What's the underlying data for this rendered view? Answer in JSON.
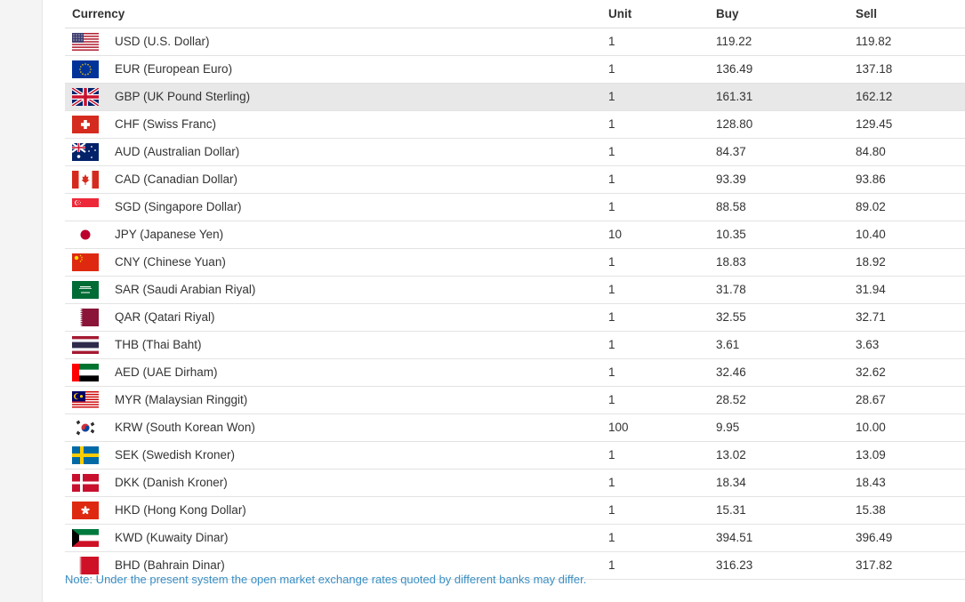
{
  "table": {
    "headers": {
      "currency": "Currency",
      "unit": "Unit",
      "buy": "Buy",
      "sell": "Sell"
    },
    "rows": [
      {
        "flag": "us-flag-icon",
        "currency": "USD (U.S. Dollar)",
        "unit": "1",
        "buy": "119.22",
        "sell": "119.82"
      },
      {
        "flag": "eu-flag-icon",
        "currency": "EUR (European Euro)",
        "unit": "1",
        "buy": "136.49",
        "sell": "137.18"
      },
      {
        "flag": "uk-flag-icon",
        "currency": "GBP (UK Pound Sterling)",
        "unit": "1",
        "buy": "161.31",
        "sell": "162.12"
      },
      {
        "flag": "ch-flag-icon",
        "currency": "CHF (Swiss Franc)",
        "unit": "1",
        "buy": "128.80",
        "sell": "129.45"
      },
      {
        "flag": "au-flag-icon",
        "currency": "AUD (Australian Dollar)",
        "unit": "1",
        "buy": "84.37",
        "sell": "84.80"
      },
      {
        "flag": "ca-flag-icon",
        "currency": "CAD (Canadian Dollar)",
        "unit": "1",
        "buy": "93.39",
        "sell": "93.86"
      },
      {
        "flag": "sg-flag-icon",
        "currency": "SGD (Singapore Dollar)",
        "unit": "1",
        "buy": "88.58",
        "sell": "89.02"
      },
      {
        "flag": "jp-flag-icon",
        "currency": "JPY (Japanese Yen)",
        "unit": "10",
        "buy": "10.35",
        "sell": "10.40"
      },
      {
        "flag": "cn-flag-icon",
        "currency": "CNY (Chinese Yuan)",
        "unit": "1",
        "buy": "18.83",
        "sell": "18.92"
      },
      {
        "flag": "sa-flag-icon",
        "currency": "SAR (Saudi Arabian Riyal)",
        "unit": "1",
        "buy": "31.78",
        "sell": "31.94"
      },
      {
        "flag": "qa-flag-icon",
        "currency": "QAR (Qatari Riyal)",
        "unit": "1",
        "buy": "32.55",
        "sell": "32.71"
      },
      {
        "flag": "th-flag-icon",
        "currency": "THB (Thai Baht)",
        "unit": "1",
        "buy": "3.61",
        "sell": "3.63"
      },
      {
        "flag": "ae-flag-icon",
        "currency": "AED (UAE Dirham)",
        "unit": "1",
        "buy": "32.46",
        "sell": "32.62"
      },
      {
        "flag": "my-flag-icon",
        "currency": "MYR (Malaysian Ringgit)",
        "unit": "1",
        "buy": "28.52",
        "sell": "28.67"
      },
      {
        "flag": "kr-flag-icon",
        "currency": "KRW (South Korean Won)",
        "unit": "100",
        "buy": "9.95",
        "sell": "10.00"
      },
      {
        "flag": "se-flag-icon",
        "currency": "SEK (Swedish Kroner)",
        "unit": "1",
        "buy": "13.02",
        "sell": "13.09"
      },
      {
        "flag": "dk-flag-icon",
        "currency": "DKK (Danish Kroner)",
        "unit": "1",
        "buy": "18.34",
        "sell": "18.43"
      },
      {
        "flag": "hk-flag-icon",
        "currency": "HKD (Hong Kong Dollar)",
        "unit": "1",
        "buy": "15.31",
        "sell": "15.38"
      },
      {
        "flag": "kw-flag-icon",
        "currency": "KWD (Kuwaity Dinar)",
        "unit": "1",
        "buy": "394.51",
        "sell": "396.49"
      },
      {
        "flag": "bh-flag-icon",
        "currency": "BHD (Bahrain Dinar)",
        "unit": "1",
        "buy": "316.23",
        "sell": "317.82"
      }
    ],
    "highlighted_row": 2
  },
  "note": "Note: Under the present system the open market exchange rates quoted by different banks may differ.",
  "colors": {
    "note_text": "#3a8fc4",
    "highlight_row": "#e8e8e8",
    "text": "#333333"
  }
}
